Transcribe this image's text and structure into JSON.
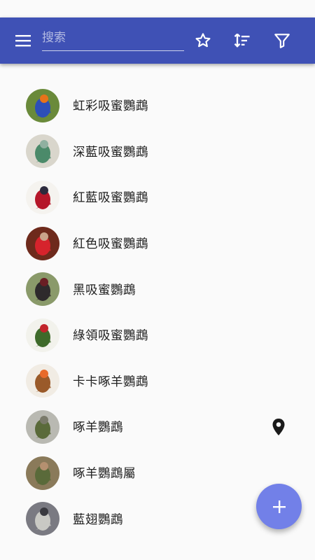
{
  "header": {
    "search_placeholder": "搜索",
    "menu_icon": "menu-icon",
    "star_icon": "star-outline-icon",
    "sort_icon": "sort-icon",
    "filter_icon": "filter-icon",
    "color": "#3f51b5"
  },
  "items": [
    {
      "name": "虹彩吸蜜鸚鵡",
      "colors": [
        "#6a8a3a",
        "#2d4fb8",
        "#e8731a"
      ],
      "has_pin": false
    },
    {
      "name": "深藍吸蜜鸚鵡",
      "colors": [
        "#d9d6cc",
        "#4b8a6a",
        "#8fb0a0"
      ],
      "has_pin": false
    },
    {
      "name": "紅藍吸蜜鸚鵡",
      "colors": [
        "#f5f3ef",
        "#b5172a",
        "#2c2a3c"
      ],
      "has_pin": false
    },
    {
      "name": "紅色吸蜜鸚鵡",
      "colors": [
        "#6e2a1c",
        "#d6232c",
        "#c9a48a"
      ],
      "has_pin": false
    },
    {
      "name": "黑吸蜜鸚鵡",
      "colors": [
        "#8a9a6a",
        "#2e2a2c",
        "#6a1e24"
      ],
      "has_pin": false
    },
    {
      "name": "綠領吸蜜鸚鵡",
      "colors": [
        "#f2f2ec",
        "#3e6a2a",
        "#c2242a"
      ],
      "has_pin": false
    },
    {
      "name": "卡卡啄羊鸚鵡",
      "colors": [
        "#f1ece4",
        "#9a5a2a",
        "#e86a2a"
      ],
      "has_pin": false
    },
    {
      "name": "啄羊鸚鵡",
      "colors": [
        "#b9b9b2",
        "#5a6a3a",
        "#7a7a6a"
      ],
      "has_pin": true
    },
    {
      "name": "啄羊鸚鵡屬",
      "colors": [
        "#8a7a5a",
        "#5a6a3a",
        "#b59070"
      ],
      "has_pin": false
    },
    {
      "name": "藍翅鸚鵡",
      "colors": [
        "#7a7a82",
        "#c9c9c4",
        "#3a3a40"
      ],
      "has_pin": false
    }
  ],
  "fab": {
    "icon": "add-icon",
    "color": "#7280e8"
  }
}
